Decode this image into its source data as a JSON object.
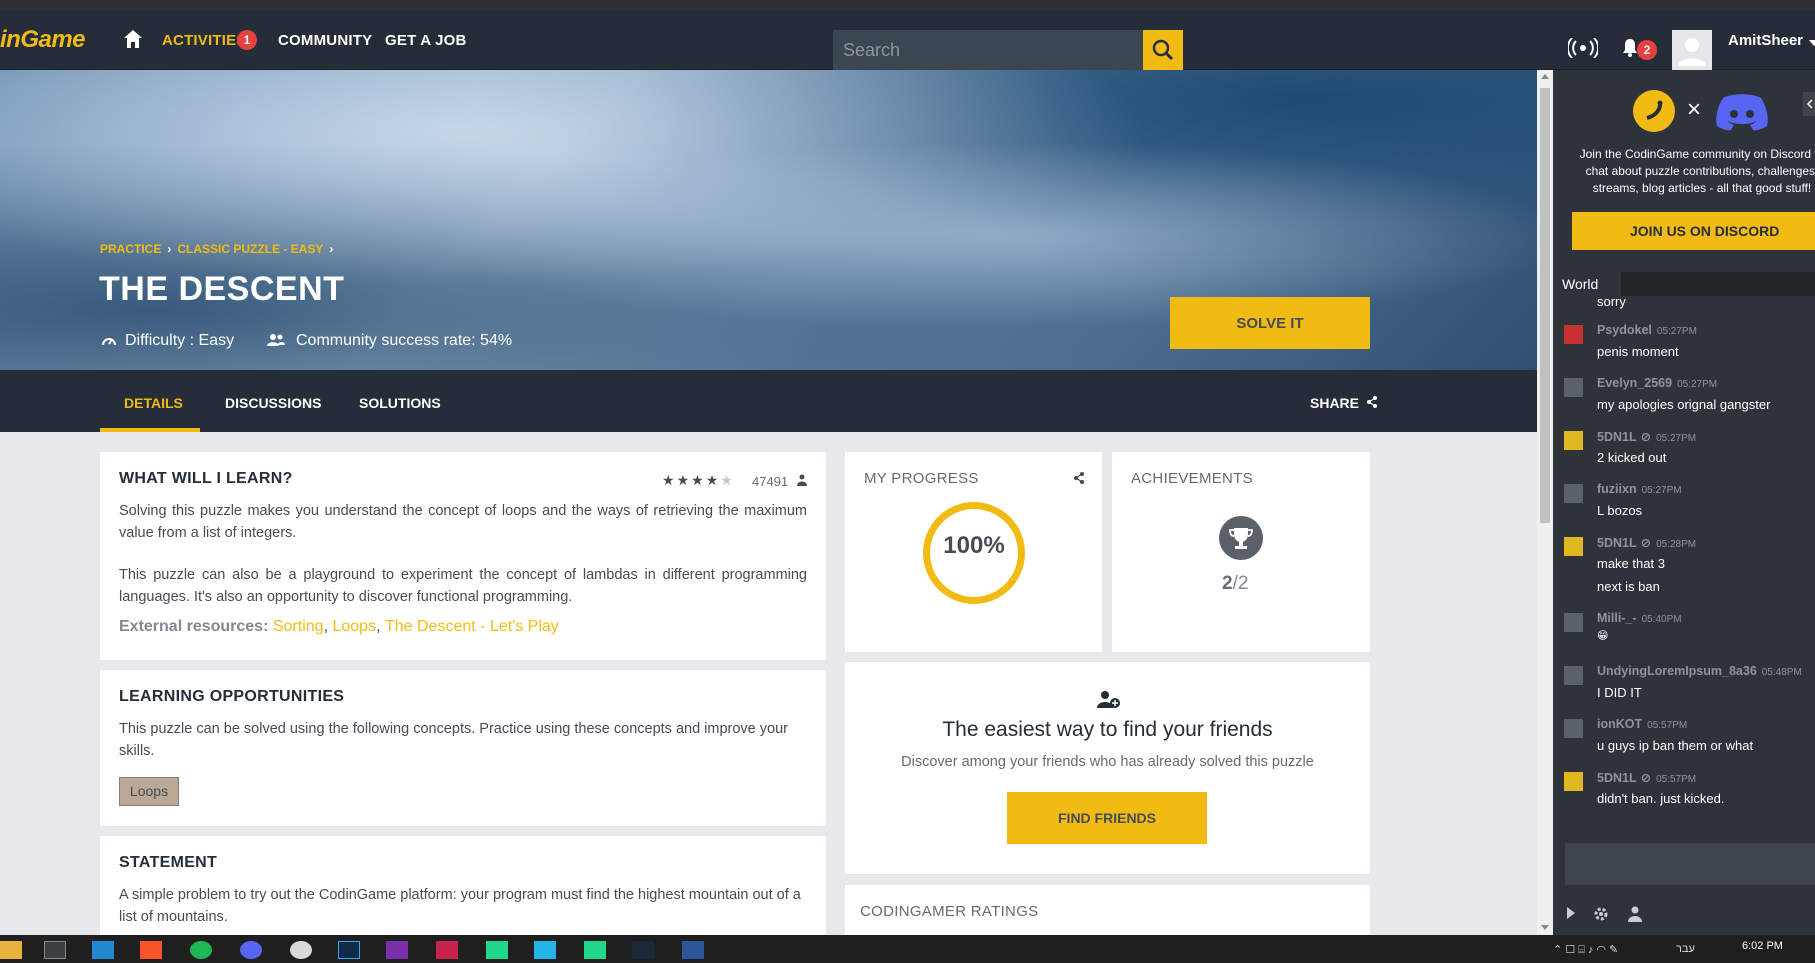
{
  "nav": {
    "logo": "inGame",
    "activities": "ACTIVITIES",
    "activities_badge": "1",
    "community": "COMMUNITY",
    "job": "GET A JOB",
    "search_placeholder": "Search",
    "notif_badge": "2",
    "username": "AmitSheer"
  },
  "hero": {
    "breadcrumb": [
      "PRACTICE",
      "CLASSIC PUZZLE - EASY"
    ],
    "title": "THE DESCENT",
    "difficulty": "Difficulty : Easy",
    "success_rate": "Community success rate: 54%",
    "solve_label": "SOLVE IT"
  },
  "tabs": {
    "details": "DETAILS",
    "discussions": "DISCUSSIONS",
    "solutions": "SOLUTIONS",
    "share": "SHARE"
  },
  "learn": {
    "title": "WHAT WILL I LEARN?",
    "rating_stars": 4,
    "rating_count": "47491",
    "para1": "Solving this puzzle makes you understand the concept of loops and the ways of retrieving the maximum value from a list of integers.",
    "para2": "This puzzle can also be a playground to experiment the concept of lambdas in different programming languages. It's also an opportunity to discover functional programming.",
    "ext_label": "External resources:",
    "ext_links": [
      "Sorting",
      "Loops",
      "The Descent - Let's Play"
    ]
  },
  "opportunities": {
    "title": "LEARNING OPPORTUNITIES",
    "text": "This puzzle can be solved using the following concepts. Practice using these concepts and improve your skills.",
    "tag": "Loops"
  },
  "statement": {
    "title": "STATEMENT",
    "text": "A simple problem to try out the CodinGame platform: your program must find the highest mountain out of a list of mountains."
  },
  "progress": {
    "title": "MY PROGRESS",
    "value": "100%",
    "fraction": 1.0
  },
  "achievements": {
    "title": "ACHIEVEMENTS",
    "earned": "2",
    "total": "/2"
  },
  "friends": {
    "title": "The easiest way to find your friends",
    "subtitle": "Discover among your friends who has already solved this puzzle",
    "button": "FIND FRIENDS"
  },
  "ratings": {
    "title": "CODINGAMER RATINGS"
  },
  "chat": {
    "discord_text": "Join the CodinGame community on Discord to chat about puzzle contributions, challenges, streams, blog articles - all that good stuff!",
    "discord_button": "JOIN US ON DISCORD",
    "tab": "World",
    "messages": [
      {
        "name": "",
        "time": "",
        "lines": [
          "sorry"
        ],
        "avatar": "none"
      },
      {
        "name": "Psydokel",
        "time": "05:27PM",
        "lines": [
          "penis moment"
        ],
        "avatar": "red"
      },
      {
        "name": "Evelyn_2569",
        "time": "05:27PM",
        "lines": [
          "my apologies orignal gangster"
        ],
        "avatar": "grey"
      },
      {
        "name": "5DN1L",
        "time": "05:27PM",
        "lines": [
          "2 kicked out"
        ],
        "avatar": "sdn"
      },
      {
        "name": "fuziixn",
        "time": "05:27PM",
        "lines": [
          "L bozos"
        ],
        "avatar": "grey"
      },
      {
        "name": "5DN1L",
        "time": "05:28PM",
        "lines": [
          "make that 3",
          "next is ban"
        ],
        "avatar": "sdn"
      },
      {
        "name": "Milli-_-",
        "time": "05:40PM",
        "lines": [
          "😁"
        ],
        "avatar": "grey"
      },
      {
        "name": "UndyingLoremIpsum_8a36",
        "time": "05:48PM",
        "lines": [
          "I DID IT"
        ],
        "avatar": "grey"
      },
      {
        "name": "ionKOT",
        "time": "05:57PM",
        "lines": [
          "u guys ip ban them or what"
        ],
        "avatar": "grey"
      },
      {
        "name": "5DN1L",
        "time": "05:57PM",
        "lines": [
          "didn't ban. just kicked."
        ],
        "avatar": "sdn"
      }
    ]
  },
  "taskbar": {
    "time": "6:02 PM",
    "lang": "עבר"
  },
  "colors": {
    "accent": "#f2bb13",
    "navbar": "#252e38",
    "chat_bg": "#2d3338"
  }
}
